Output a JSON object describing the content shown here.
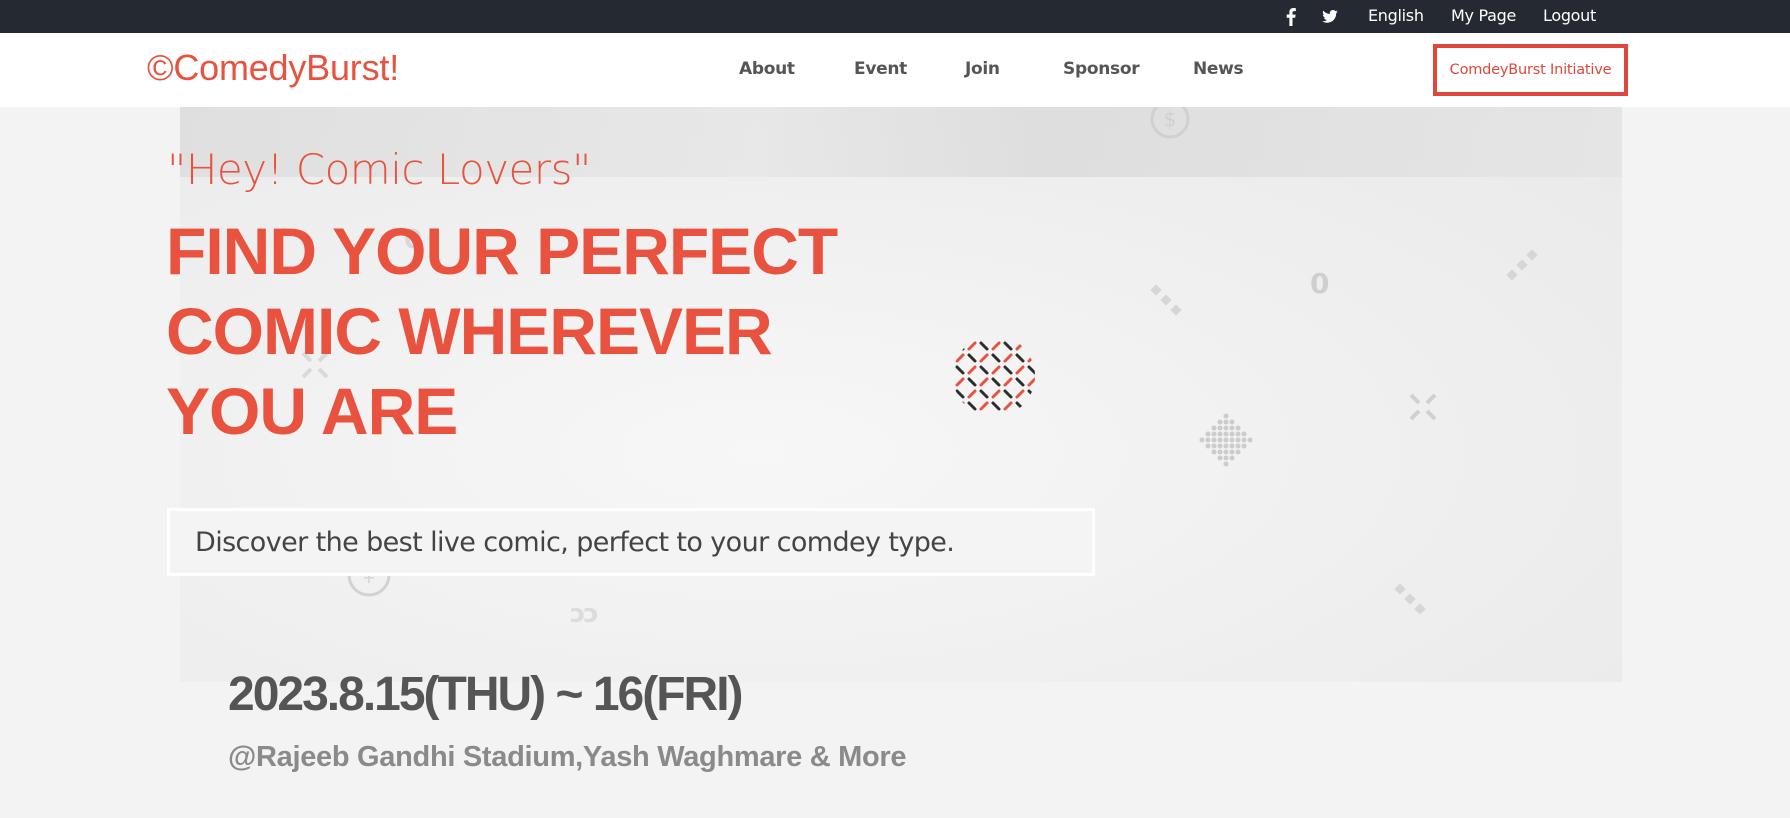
{
  "topbar": {
    "social": [
      {
        "icon": "facebook-icon"
      },
      {
        "icon": "twitter-icon"
      }
    ],
    "links": [
      "English",
      "My Page",
      "Logout"
    ]
  },
  "header": {
    "logo": "©ComedyBurst!",
    "nav": [
      "About",
      "Event",
      "Join",
      "Sponsor",
      "News"
    ],
    "cta": "ComdeyBurst Initiative"
  },
  "hero": {
    "tagline": "\"Hey! Comic Lovers\"",
    "headline": [
      "FIND YOUR PERFECT",
      "COMIC WHEREVER",
      "YOU ARE"
    ],
    "discover": "Discover the best live comic, perfect to your comdey type.",
    "date": "2023.8.15(THU) ~ 16(FRI)",
    "venue": "@Rajeeb Gandhi Stadium,Yash Waghmare & More"
  },
  "colors": {
    "accent": "#e8523f",
    "topbar": "#252932",
    "text_dark": "#555555"
  }
}
